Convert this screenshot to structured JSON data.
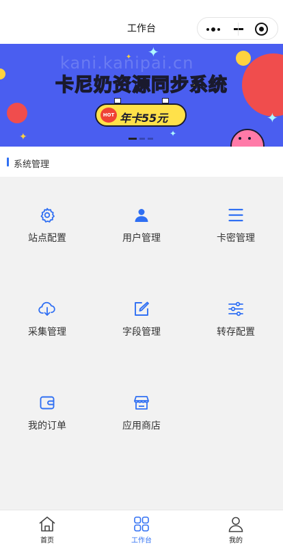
{
  "nav": {
    "title": "工作台"
  },
  "banner": {
    "title": "卡尼奶资源同步系统",
    "badge_hot": "HOT",
    "badge_text": "年卡55元",
    "watermark": "kani.kanipai.cn",
    "slides_count": 3,
    "active_slide": 1
  },
  "section": {
    "title": "系统管理"
  },
  "grid": [
    {
      "label": "站点配置",
      "icon": "gear-icon"
    },
    {
      "label": "用户管理",
      "icon": "user-icon"
    },
    {
      "label": "卡密管理",
      "icon": "menu-icon"
    },
    {
      "label": "采集管理",
      "icon": "cloud-download-icon"
    },
    {
      "label": "字段管理",
      "icon": "edit-icon"
    },
    {
      "label": "转存配置",
      "icon": "sliders-icon"
    },
    {
      "label": "我的订单",
      "icon": "wallet-icon"
    },
    {
      "label": "应用商店",
      "icon": "store-icon"
    }
  ],
  "tabbar": [
    {
      "label": "首页",
      "icon": "home-icon",
      "active": false
    },
    {
      "label": "工作台",
      "icon": "grid-icon",
      "active": true
    },
    {
      "label": "我的",
      "icon": "user-outline-icon",
      "active": false
    }
  ],
  "colors": {
    "accent": "#2f6ff3",
    "banner_bg": "#4a5ef0",
    "badge_yellow": "#ffe14a"
  }
}
